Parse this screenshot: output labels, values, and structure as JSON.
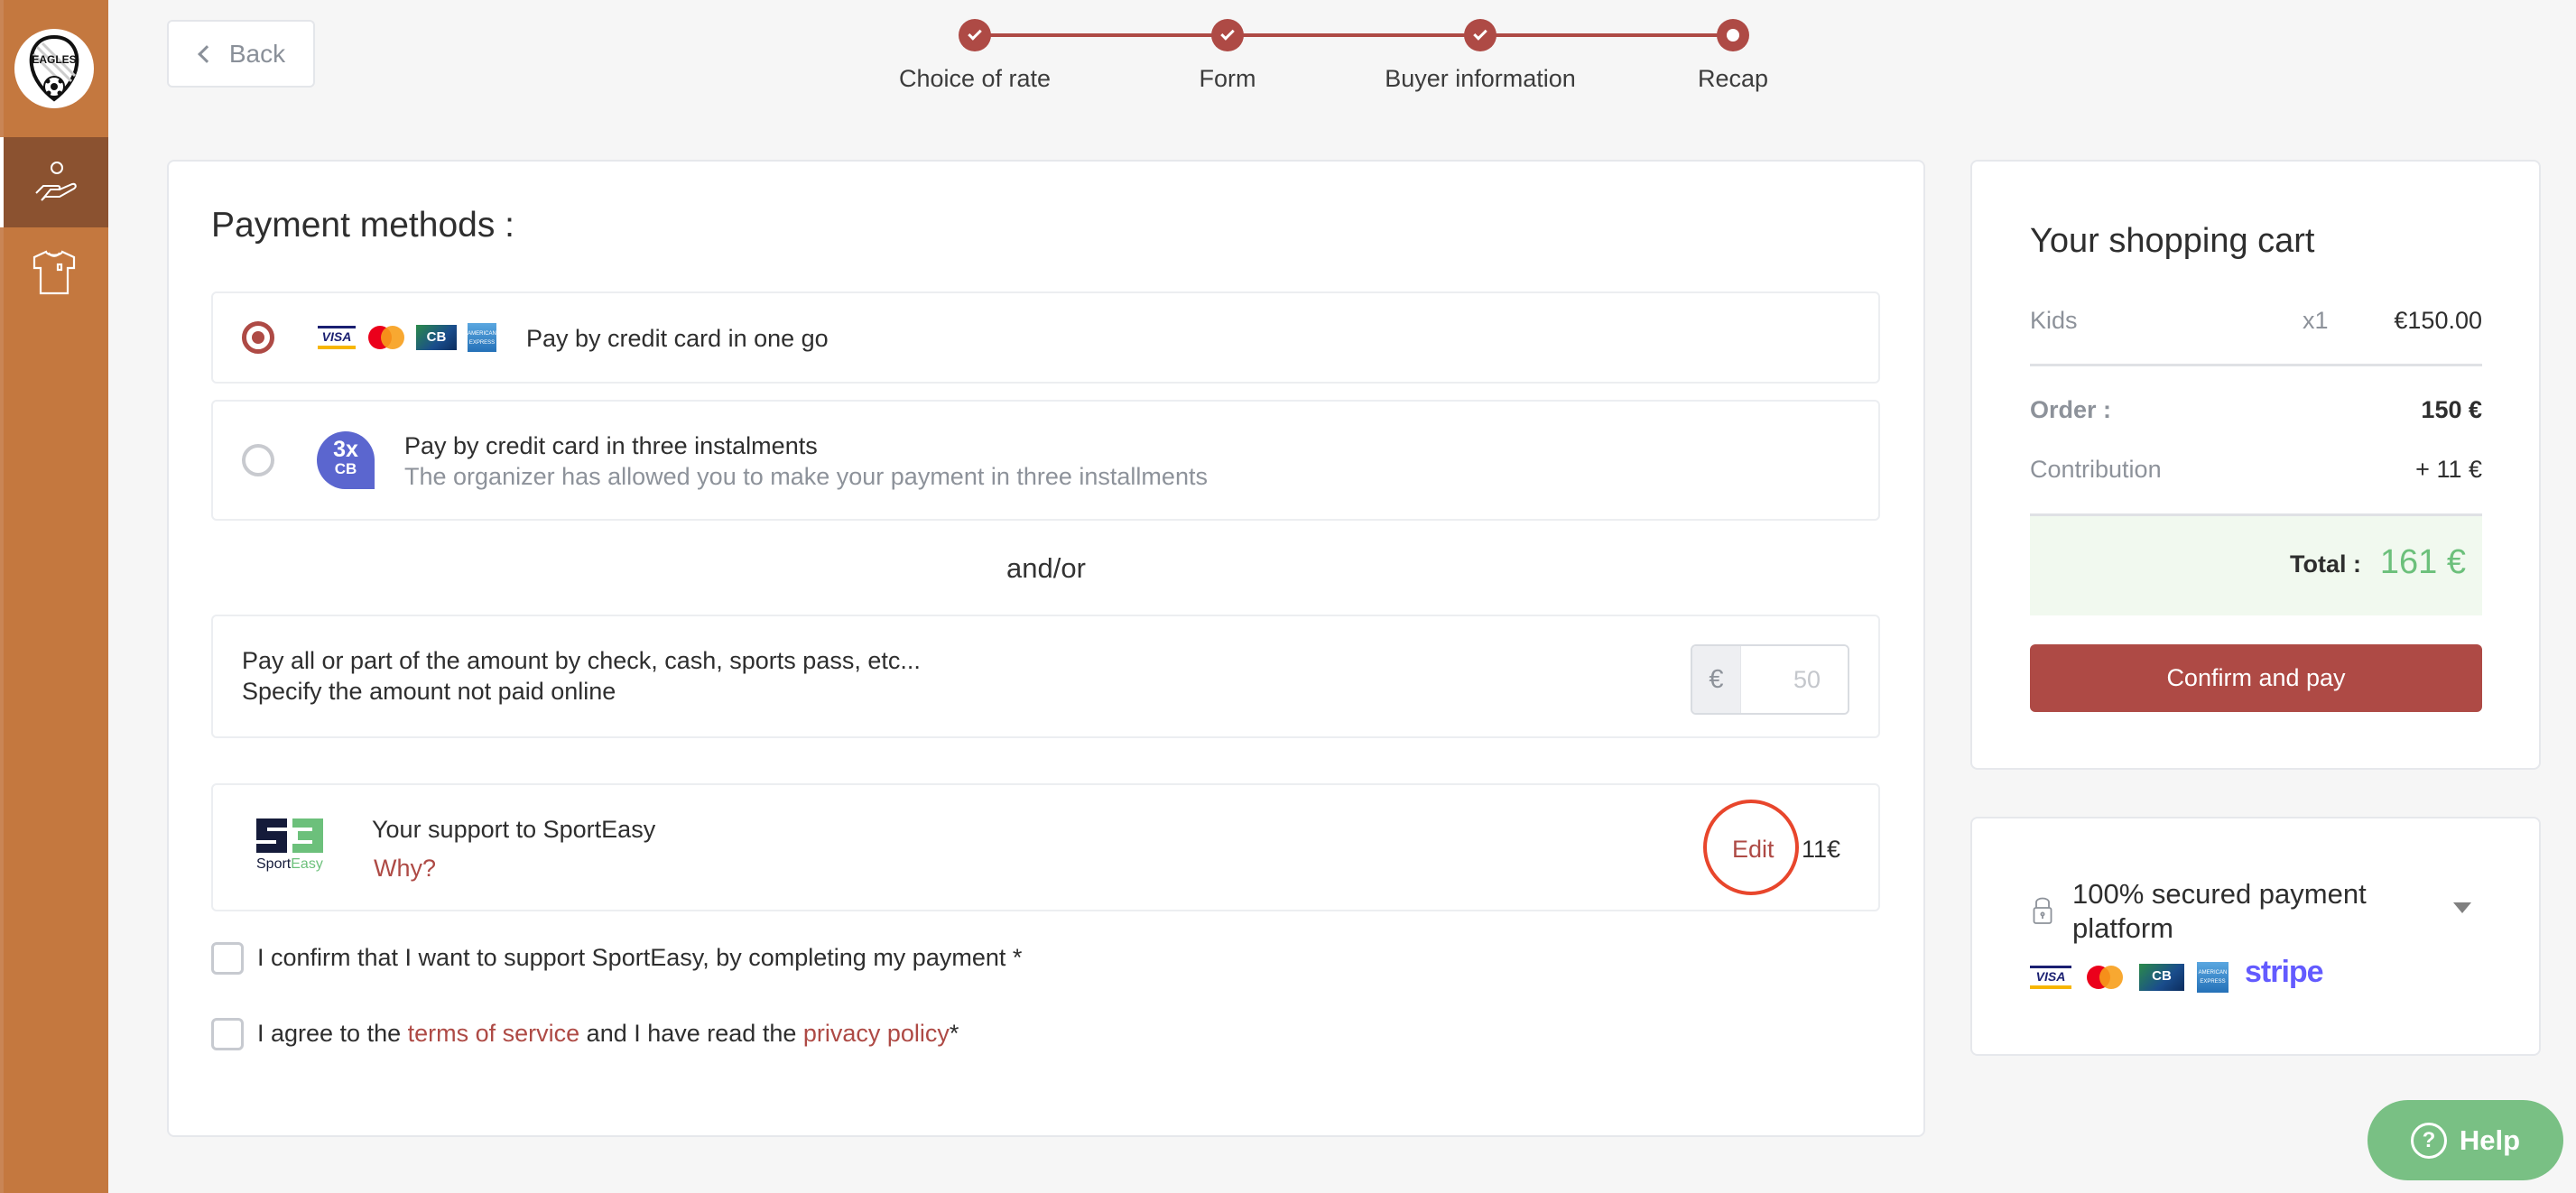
{
  "sidebar": {
    "logo_text": "EAGLES",
    "items": [
      {
        "name": "donation",
        "icon": "hand-holding-icon",
        "active": true
      },
      {
        "name": "shop",
        "icon": "shirt-icon",
        "active": false
      }
    ]
  },
  "header": {
    "back_label": "Back",
    "steps": [
      {
        "label": "Choice of rate",
        "state": "done"
      },
      {
        "label": "Form",
        "state": "done"
      },
      {
        "label": "Buyer information",
        "state": "done"
      },
      {
        "label": "Recap",
        "state": "current"
      }
    ]
  },
  "payment": {
    "title": "Payment methods :",
    "options": [
      {
        "label": "Pay by credit card in one go",
        "selected": true,
        "cards": [
          "VISA",
          "Mastercard",
          "CB",
          "American Express"
        ]
      },
      {
        "label": "Pay by credit card in three instalments",
        "sublabel": "The organizer has allowed you to make your payment in three installments",
        "selected": false,
        "badge_big": "3x",
        "badge_small": "CB"
      }
    ],
    "andor": "and/or",
    "offline": {
      "line1": "Pay all or part of the amount by check, cash, sports pass, etc...",
      "line2": "Specify the amount not paid online",
      "currency": "€",
      "placeholder": "50",
      "value": ""
    },
    "support": {
      "logo_top": "SE",
      "logo_sport": "Sport",
      "logo_easy": "Easy",
      "label": "Your support to SportEasy",
      "why": "Why?",
      "edit": "Edit",
      "amount": "11€"
    },
    "checks": [
      {
        "text": "I confirm that I want to support SportEasy, by completing my payment *",
        "checked": false
      },
      {
        "prefix": "I agree to the ",
        "link1": "terms of service",
        "middle": " and I have read the ",
        "link2": "privacy policy",
        "suffix": "*",
        "checked": false
      }
    ]
  },
  "cart": {
    "title": "Your shopping cart",
    "items": [
      {
        "name": "Kids",
        "qty": "x1",
        "price": "€150.00"
      }
    ],
    "order_label": "Order :",
    "order_value": "150 €",
    "contribution_label": "Contribution",
    "contribution_value": "+ 11 €",
    "total_label": "Total :",
    "total_value": "161 €",
    "pay_button": "Confirm and pay"
  },
  "secure": {
    "text": "100% secured payment platform",
    "brands": [
      "VISA",
      "Mastercard",
      "CB",
      "American Express",
      "stripe"
    ]
  },
  "help": {
    "label": "Help"
  },
  "colors": {
    "sidebar": "#c4783f",
    "sidebar_active": "#8b5230",
    "accent": "#ae4a45",
    "success": "#6cc07b",
    "help": "#79c084",
    "annotation": "#e8462c"
  }
}
